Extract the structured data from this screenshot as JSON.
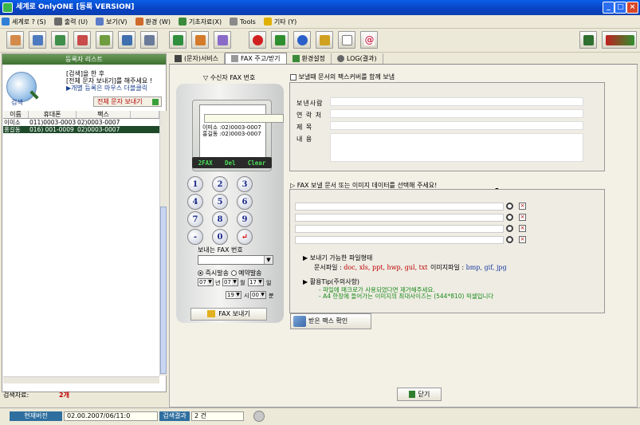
{
  "window": {
    "title": "세계로 OnlyONE [등록 VERSION]"
  },
  "menu": [
    {
      "label": "세계로 ? (S)",
      "color": "#2f7fd9"
    },
    {
      "label": "출력 (U)",
      "color": "#6a6a6a"
    },
    {
      "label": "보기(V)",
      "color": "#5a7bc9"
    },
    {
      "label": "환경 (W)",
      "color": "#d06a2a"
    },
    {
      "label": "기초자료(X)",
      "color": "#3c8a3c"
    },
    {
      "label": "Tools",
      "color": "#8a8a8a"
    },
    {
      "label": "기타 (Y)",
      "color": "#e0b000"
    }
  ],
  "toolbar": {
    "icons": [
      "user-icon",
      "phone-icon",
      "contact-card-icon",
      "document-icon",
      "edit-icon",
      "monitor-icon",
      "calculator-icon",
      "network-icon",
      "printer-icon",
      "chart-icon",
      "stop-icon",
      "excel-icon",
      "ie-browser-icon",
      "image-viewer-icon",
      "window-icon",
      "at-icon"
    ],
    "colors": [
      "#d48a4a",
      "#4d7abf",
      "#3f8e4a",
      "#c94a4a",
      "#6f9d3f",
      "#3f6fae",
      "#6a7a9a",
      "#2f8f3f",
      "#d47a2a",
      "#8a6ac9",
      "#d02020",
      "#2f8f2f",
      "#2a5fc9",
      "#d0a020",
      "#7a7a7a",
      "#d03050"
    ],
    "exit_icon": "exit-door-icon",
    "logo_icon": "support-logo-icon"
  },
  "left": {
    "header": "등록자 리스트",
    "search_label": "검색",
    "info_lines": [
      "[검색]을 한 후",
      "[전체 문자 보내기]를 해주세요 !",
      "▶개별 등록은 마우스 더블클릭"
    ],
    "show_all_btn": "전체 문자 보내기",
    "columns": [
      "이름",
      "휴대폰",
      "팩스"
    ],
    "rows": [
      {
        "name": "이미소",
        "mobile": "011)0003-0003",
        "fax": "02)0003-0007",
        "selected": false
      },
      {
        "name": "홍길동",
        "mobile": "016) 001-0009",
        "fax": "02)0003-0007",
        "selected": true
      }
    ],
    "result_label": "검색자료:",
    "result_count": "2개"
  },
  "tabs": [
    {
      "label": "(문자)서비스",
      "active": false
    },
    {
      "label": "FAX 주고/받기",
      "active": true
    },
    {
      "label": "환경설정",
      "active": false
    },
    {
      "label": "LOG(결과)",
      "active": false
    }
  ],
  "fax": {
    "recipient_label": "▽ 수신자 FAX 번호",
    "list": [
      "이미소  :02)0003-0007",
      "홍길동  :02)0003-0007"
    ],
    "lcd_buttons": [
      "2FAX",
      "Del",
      "Clear"
    ],
    "keys": [
      "1",
      "2",
      "3",
      "4",
      "5",
      "6",
      "7",
      "8",
      "9",
      "-",
      "0",
      "↵"
    ],
    "send_number_label": "보내는 FAX 번호",
    "send_now": "즉시발송",
    "reserve": "예약발송",
    "month": "07",
    "year_unit": "년",
    "month2": "07",
    "month_unit": "월",
    "day": "17",
    "day_unit": "일",
    "hour": "19",
    "hour_unit": "시",
    "minute": "00",
    "minute_unit": "분",
    "send_btn": "FAX 보내기"
  },
  "cover": {
    "checkbox_label": "보낼때 문서의 팩스커버를 함께 보냄",
    "fields": [
      "보낸사람",
      "연 락 처",
      "제   목",
      "내   용"
    ]
  },
  "attach": {
    "title": "▷ FAX 보낼 문서 또는 이미지 데이터를 선택해 주세요!",
    "file_types_title": "보내기 가능한 파일형태",
    "doc_label": "문서파일 :",
    "doc_types": "doc, xls, ppt, hwp, gul, txt",
    "img_label": "이미지파일 :",
    "img_types": "bmp, gif, jpg",
    "tip_title": "활용Tip(주의사항)",
    "tips": [
      "- 파일에 매크로가 사용되었다면 제거해주세요.",
      "- A4 한장에 들어가는 이미지의 최대사이즈는 (544*810) 픽셀입니다"
    ],
    "received_btn": "받은 팩스 확인"
  },
  "close_btn": "닫기",
  "status": {
    "version_label": "현재버전",
    "version_value": "02.00.2007/06/11:0",
    "result_label": "검색결과",
    "result_value": "2 건"
  }
}
